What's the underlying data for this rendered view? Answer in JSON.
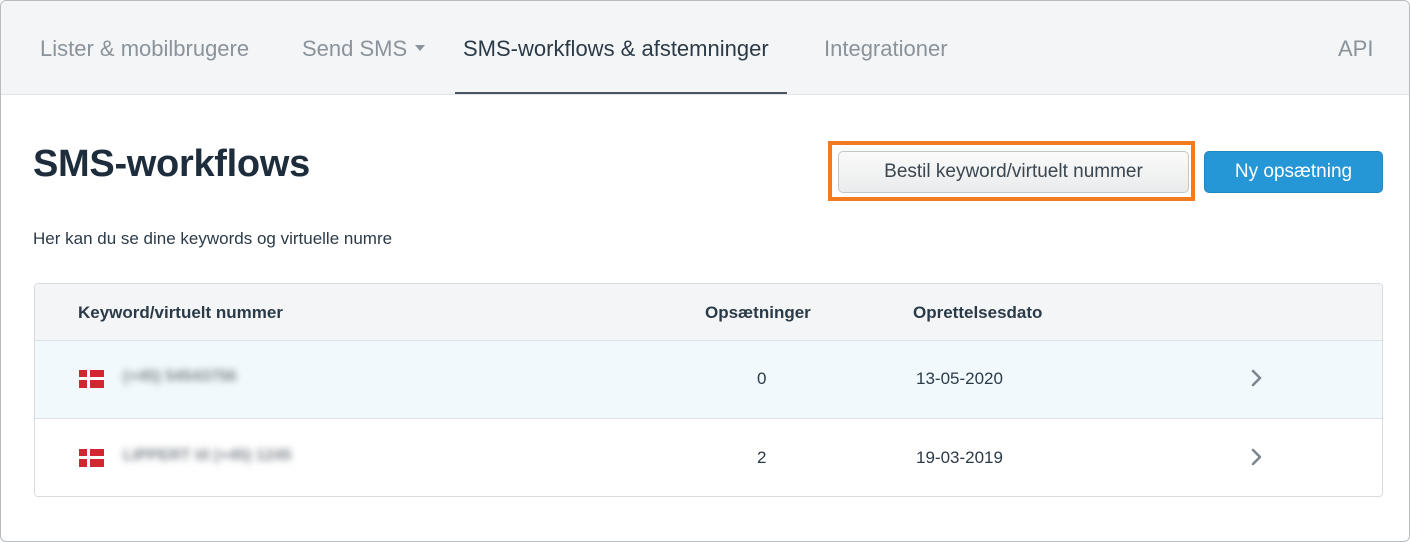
{
  "nav": {
    "items": [
      {
        "label": "Lister & mobilbrugere"
      },
      {
        "label": "Send SMS"
      },
      {
        "label": "SMS-workflows & afstemninger"
      },
      {
        "label": "Integrationer"
      },
      {
        "label": "API"
      }
    ],
    "active_index": 2
  },
  "page": {
    "title": "SMS-workflows",
    "subtitle": "Her kan du se dine keywords og virtuelle numre"
  },
  "actions": {
    "order_button": "Bestil keyword/virtuelt nummer",
    "new_button": "Ny opsætning",
    "highlight_color": "#f47a20",
    "primary_color": "#2597d7"
  },
  "table": {
    "columns": [
      "Keyword/virtuelt nummer",
      "Opsætninger",
      "Oprettelsesdato"
    ],
    "rows": [
      {
        "keyword": "(+45) 54543756",
        "setups": "0",
        "created": "13-05-2020",
        "flag": "denmark-flag-icon"
      },
      {
        "keyword": "LIPPERT til (+45) 1245",
        "setups": "2",
        "created": "19-03-2019",
        "flag": "denmark-flag-icon"
      }
    ]
  }
}
